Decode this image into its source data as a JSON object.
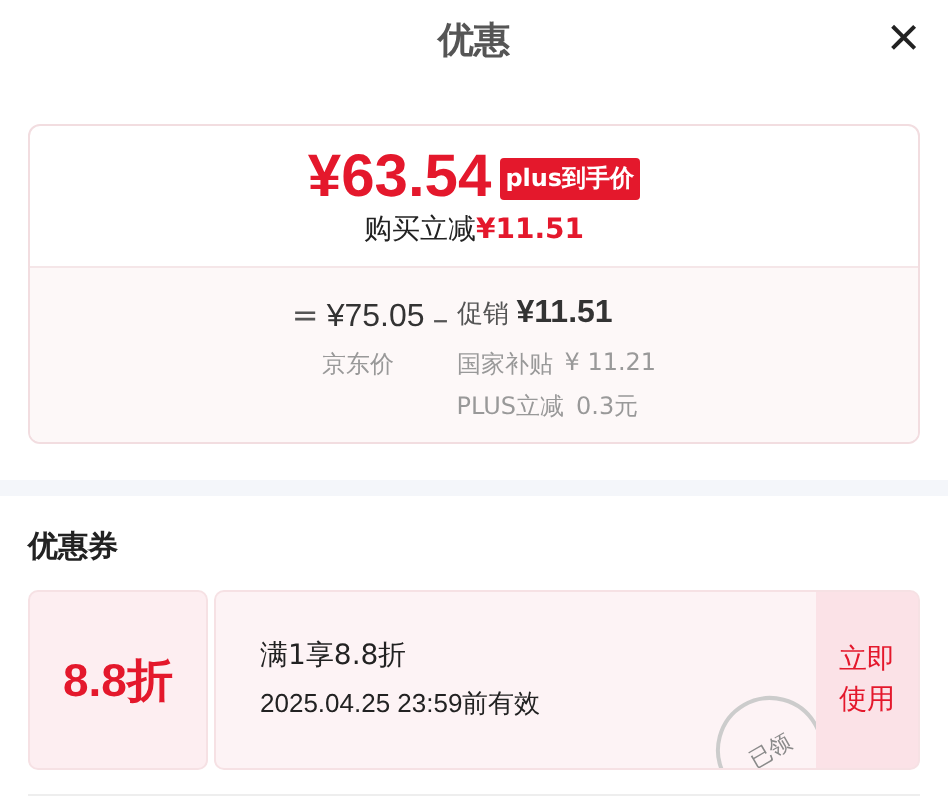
{
  "header": {
    "title": "优惠",
    "close": "×"
  },
  "price_card": {
    "final_price": "¥63.54",
    "badge": "plus到手价",
    "saving_label": "购买立减",
    "saving_amount": "¥11.51",
    "breakdown": {
      "equals": "=",
      "base_price": "¥75.05",
      "base_label": "京东价",
      "minus": "–",
      "promo_label": "促销",
      "promo_amount": "¥11.51",
      "details": [
        {
          "label": "国家补贴",
          "value": "¥ 11.21"
        },
        {
          "label": "PLUS立减",
          "value": "0.3元"
        }
      ]
    }
  },
  "coupons": {
    "title": "优惠券",
    "items": [
      {
        "discount": "8.8折",
        "condition": "满1享8.8折",
        "validity": "2025.04.25 23:59前有效",
        "stamp": "已领",
        "action": "立即使用"
      }
    ]
  }
}
